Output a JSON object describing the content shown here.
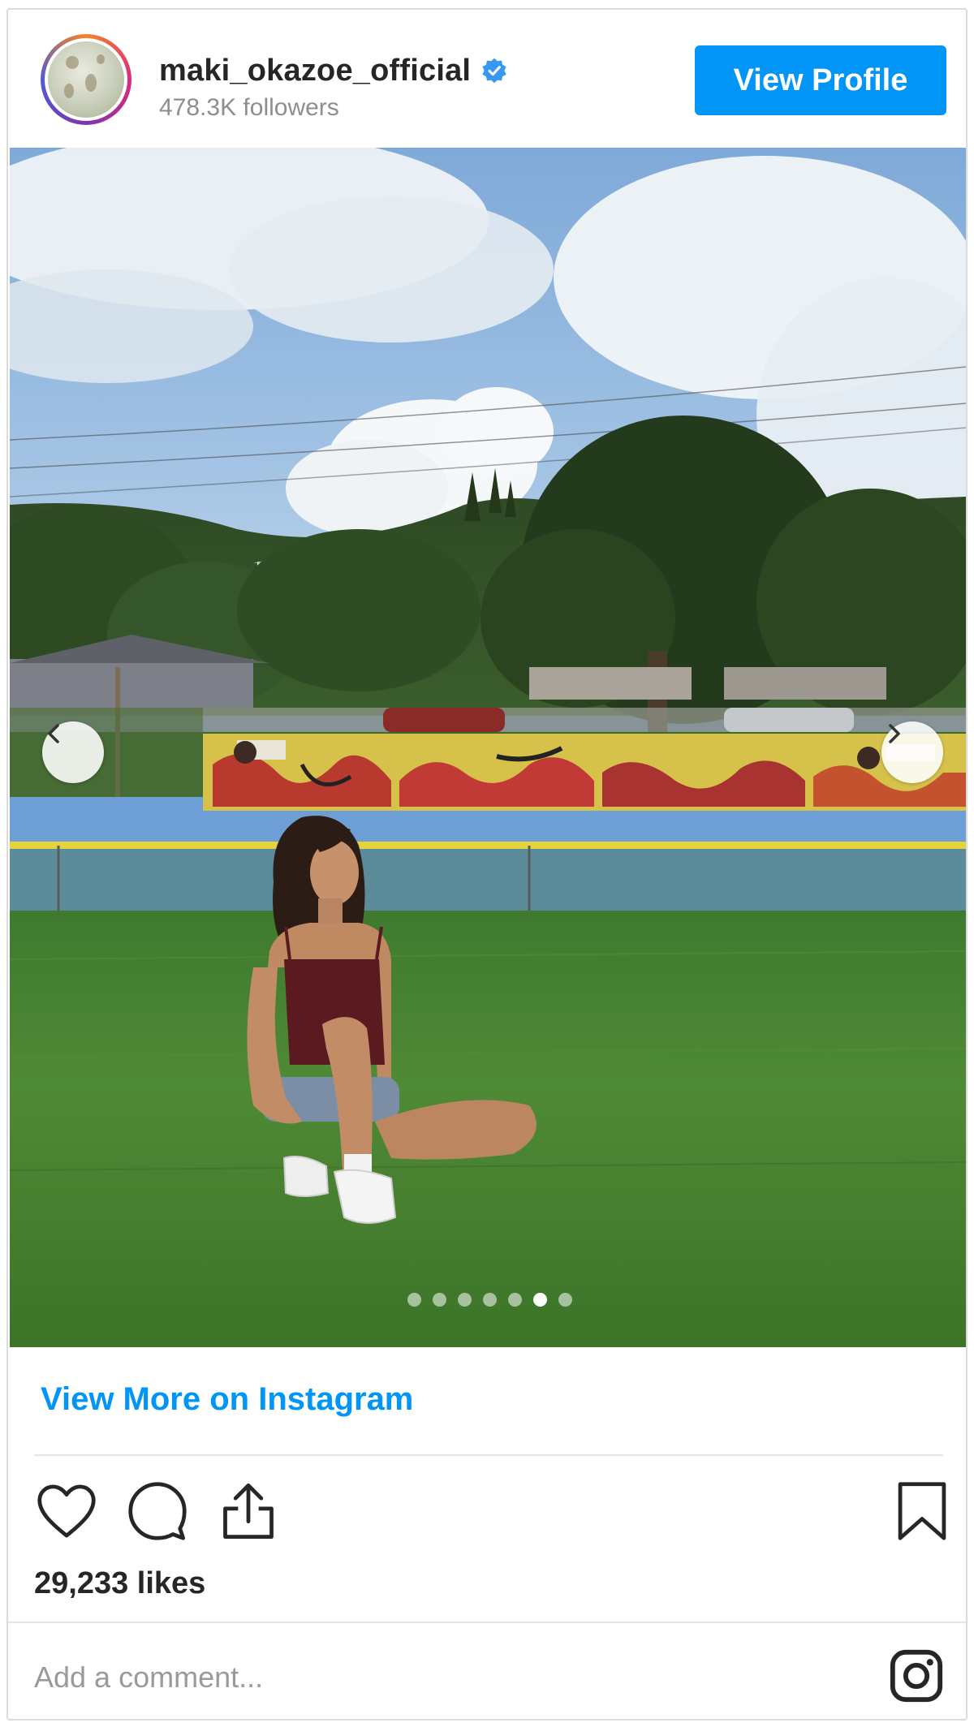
{
  "header": {
    "username": "maki_okazoe_official",
    "verified": true,
    "followers": "478.3K followers",
    "view_profile_label": "View Profile"
  },
  "media": {
    "carousel_total": 7,
    "carousel_active_index": 5,
    "prev_icon": "chevron-left-icon",
    "next_icon": "chevron-right-icon"
  },
  "footer": {
    "view_more_label": "View More on Instagram",
    "likes": "29,233 likes",
    "comment_placeholder": "Add a comment...",
    "icons": [
      "heart-icon",
      "comment-icon",
      "share-icon",
      "bookmark-icon",
      "instagram-logo-icon"
    ]
  },
  "colors": {
    "accent": "#0095f6",
    "text": "#262626",
    "muted": "#8e8e8e",
    "border": "#dbdbdb"
  }
}
